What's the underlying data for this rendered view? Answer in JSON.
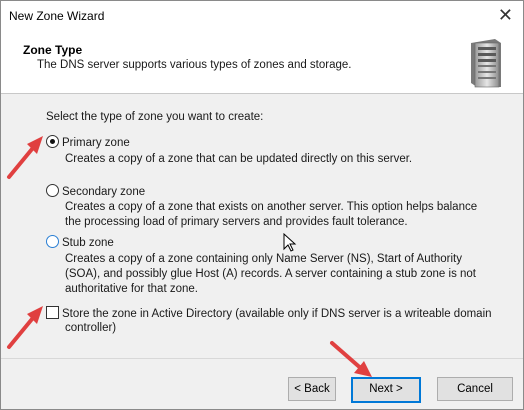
{
  "window": {
    "title": "New Zone Wizard",
    "close_glyph": "✕"
  },
  "header": {
    "title": "Zone Type",
    "subtitle": "The DNS server supports various types of zones and storage."
  },
  "prompt": "Select the type of zone you want to create:",
  "options": [
    {
      "label": "Primary zone",
      "selected": true,
      "description": [
        "Creates a copy of a zone that can be updated directly on this server."
      ]
    },
    {
      "label": "Secondary zone",
      "selected": false,
      "description": [
        "Creates a copy of a zone that exists on another server. This option helps balance",
        "the processing load of primary servers and provides fault tolerance."
      ]
    },
    {
      "label": "Stub zone",
      "selected": false,
      "description": [
        "Creates a copy of a zone containing only Name Server (NS), Start of Authority",
        "(SOA), and possibly glue Host (A) records. A server containing a stub zone is not",
        "authoritative for that zone."
      ]
    }
  ],
  "store_ad": {
    "checked": false,
    "label_line1": "Store the zone in Active Directory (available only if DNS server is a writeable domain",
    "label_line2": "controller)"
  },
  "buttons": {
    "back": "< Back",
    "next": "Next >",
    "cancel": "Cancel"
  },
  "colors": {
    "annotation_arrow": "#e04040",
    "focus_border": "#0078d7",
    "header_bg": "#ffffff",
    "dialog_bg": "#f0f0f0"
  },
  "icons": {
    "header": "server-tower-icon",
    "close": "close-icon"
  }
}
